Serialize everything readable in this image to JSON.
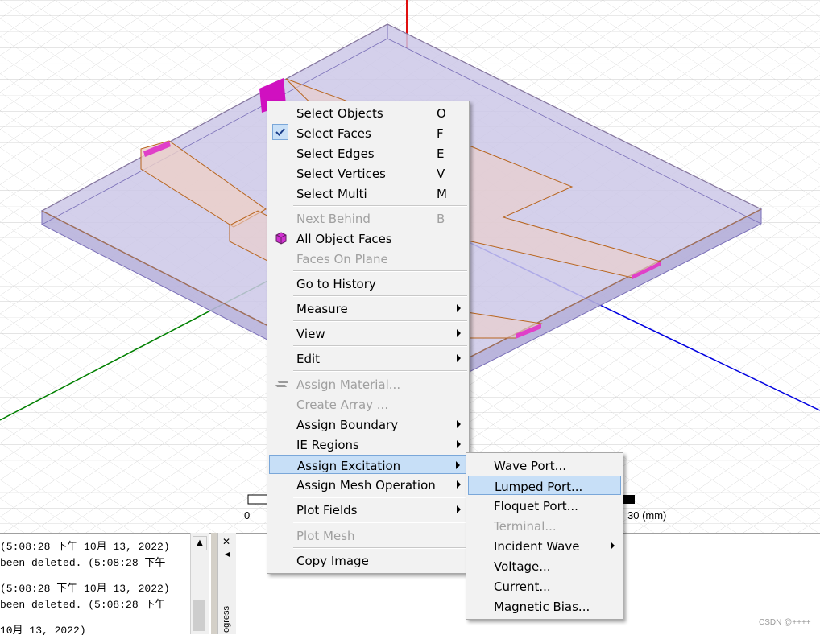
{
  "context_menu": {
    "items": [
      {
        "label": "Select Objects",
        "shortcut": "O",
        "enabled": true
      },
      {
        "label": "Select Faces",
        "shortcut": "F",
        "enabled": true,
        "checked": true
      },
      {
        "label": "Select Edges",
        "shortcut": "E",
        "enabled": true
      },
      {
        "label": "Select Vertices",
        "shortcut": "V",
        "enabled": true
      },
      {
        "label": "Select Multi",
        "shortcut": "M",
        "enabled": true
      },
      {
        "label": "Next Behind",
        "shortcut": "B",
        "enabled": false
      },
      {
        "label": "All Object Faces",
        "enabled": true,
        "icon": "cube-icon"
      },
      {
        "label": "Faces On Plane",
        "enabled": false
      },
      {
        "label": "Go to History",
        "enabled": true
      },
      {
        "label": "Measure",
        "enabled": true,
        "submenu": true
      },
      {
        "label": "View",
        "enabled": true,
        "submenu": true
      },
      {
        "label": "Edit",
        "enabled": true,
        "submenu": true
      },
      {
        "label": "Assign Material...",
        "enabled": false,
        "icon": "material-icon"
      },
      {
        "label": "Create Array ...",
        "enabled": false
      },
      {
        "label": "Assign Boundary",
        "enabled": true,
        "submenu": true
      },
      {
        "label": "IE Regions",
        "enabled": true,
        "submenu": true
      },
      {
        "label": "Assign Excitation",
        "enabled": true,
        "submenu": true,
        "highlighted": true
      },
      {
        "label": "Assign Mesh Operation",
        "enabled": true,
        "submenu": true
      },
      {
        "label": "Plot Fields",
        "enabled": true,
        "submenu": true
      },
      {
        "label": "Plot Mesh",
        "enabled": false
      },
      {
        "label": "Copy Image",
        "enabled": true
      }
    ]
  },
  "excitation_submenu": {
    "items": [
      {
        "label": "Wave Port...",
        "enabled": true
      },
      {
        "label": "Lumped Port...",
        "enabled": true,
        "highlighted": true
      },
      {
        "label": "Floquet Port...",
        "enabled": true
      },
      {
        "label": "Terminal...",
        "enabled": false
      },
      {
        "label": "Incident Wave",
        "enabled": true,
        "submenu": true
      },
      {
        "label": "Voltage...",
        "enabled": true
      },
      {
        "label": "Current...",
        "enabled": true
      },
      {
        "label": "Magnetic Bias...",
        "enabled": true
      }
    ]
  },
  "scale_bar": {
    "start_label": "0",
    "end_label": "30 (mm)"
  },
  "message_log": {
    "lines": [
      " (5:08:28 下午  10月 13, 2022)",
      "been deleted. (5:08:28 下午",
      " (5:08:28 下午  10月 13, 2022)",
      "been deleted. (5:08:28 下午",
      " 10月 13, 2022)"
    ]
  },
  "progress_panel": {
    "tab_label": "ogress"
  },
  "watermark": "CSDN @++++",
  "colors": {
    "axis_z": "#e01010",
    "axis_x": "#0000e0",
    "axis_y": "#008000",
    "substrate_fill": "#ccc8e8",
    "trace_edge": "#b8651e",
    "port_fill": "#e020c0",
    "menu_highlight": "#c7dff7"
  }
}
